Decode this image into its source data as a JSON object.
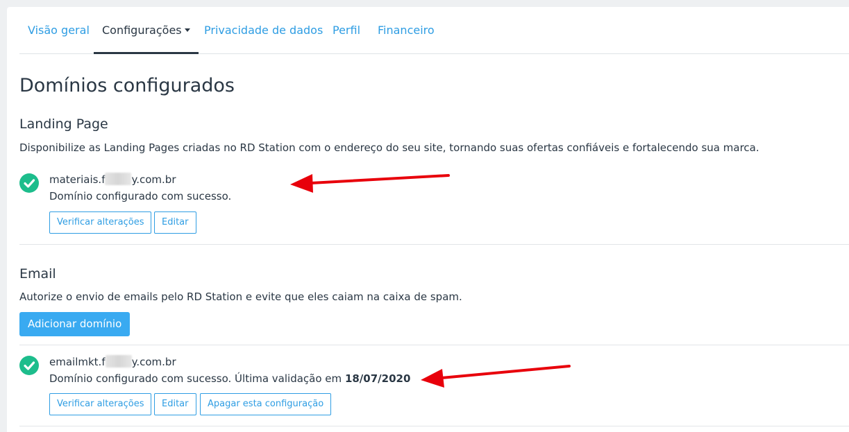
{
  "tabs": [
    {
      "label": "Visão geral"
    },
    {
      "label": "Configurações"
    },
    {
      "label": "Privacidade de dados"
    },
    {
      "label": "Perfil"
    },
    {
      "label": "Financeiro"
    }
  ],
  "page_title": "Domínios configurados",
  "landing": {
    "title": "Landing Page",
    "description": "Disponibilize as Landing Pages criadas no RD Station com o endereço do seu site, tornando suas ofertas confiáveis e fortalecendo sua marca.",
    "domain_prefix": "materiais.f",
    "domain_suffix": "y.com.br",
    "status": "Domínio configurado com sucesso.",
    "buttons": {
      "verify": "Verificar alterações",
      "edit": "Editar"
    }
  },
  "email": {
    "title": "Email",
    "description": "Autorize o envio de emails pelo RD Station e evite que eles caiam na caixa de spam.",
    "add_button": "Adicionar domínio",
    "domain_prefix": "emailmkt.f",
    "domain_suffix": "y.com.br",
    "status": "Domínio configurado com sucesso. Última validação em",
    "validation_date": "18/07/2020",
    "buttons": {
      "verify": "Verificar alterações",
      "edit": "Editar",
      "delete": "Apagar esta configuração"
    }
  },
  "colors": {
    "accent": "#2e9de3",
    "primary_button": "#39aaf1",
    "success": "#1dbd8c",
    "arrow": "#e8000b"
  },
  "icons": {
    "status": "check-circle-icon",
    "annotation": "red-arrow-annotation"
  }
}
